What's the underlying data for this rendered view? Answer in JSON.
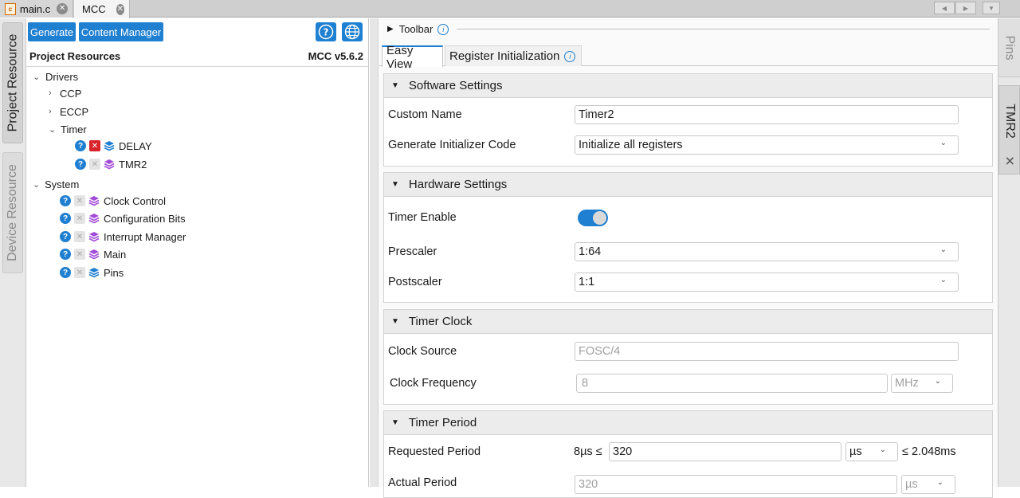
{
  "file_tabs": [
    {
      "label": "main.c",
      "icon": "c-file-icon"
    },
    {
      "label": "MCC",
      "icon": "mcc-icon"
    }
  ],
  "left_tabs": {
    "project_resource": "Project Resource",
    "device_resource": "Device Resource"
  },
  "right_tabs": {
    "pins": "Pins",
    "tmr2": "TMR2"
  },
  "toolbar_buttons": {
    "generate": "Generate",
    "content_manager": "Content Manager"
  },
  "resources": {
    "title": "Project Resources",
    "version": "MCC v5.6.2",
    "drivers_label": "Drivers",
    "ccp": "CCP",
    "eccp": "ECCP",
    "timer_label": "Timer",
    "delay": "DELAY",
    "tmr2": "TMR2",
    "system_label": "System",
    "clock_control": "Clock Control",
    "configuration_bits": "Configuration Bits",
    "interrupt_manager": "Interrupt Manager",
    "main": "Main",
    "pins": "Pins"
  },
  "editor": {
    "toolbar_label": "Toolbar",
    "tab_easy_view": "Easy View",
    "tab_register_init": "Register Initialization",
    "software_settings": {
      "title": "Software Settings",
      "custom_name_label": "Custom Name",
      "custom_name_value": "Timer2",
      "gen_init_label": "Generate Initializer Code",
      "gen_init_value": "Initialize all registers"
    },
    "hardware_settings": {
      "title": "Hardware Settings",
      "timer_enable_label": "Timer Enable",
      "timer_enable_on": true,
      "prescaler_label": "Prescaler",
      "prescaler_value": "1:64",
      "postscaler_label": "Postscaler",
      "postscaler_value": "1:1"
    },
    "timer_clock": {
      "title": "Timer Clock",
      "clock_source_label": "Clock Source",
      "clock_source_value": "FOSC/4",
      "clock_freq_label": "Clock Frequency",
      "clock_freq_value": "8",
      "clock_freq_unit": "MHz"
    },
    "timer_period": {
      "title": "Timer Period",
      "requested_label": "Requested Period",
      "requested_min": "8µs ≤",
      "requested_value": "320",
      "requested_unit": "µs",
      "requested_max": "≤ 2.048ms",
      "actual_label": "Actual Period",
      "actual_value": "320",
      "actual_unit": "µs"
    }
  },
  "colors": {
    "accent": "#1f7fd1",
    "error": "#d8232a",
    "layer_purple": "#a24bd8",
    "layer_blue": "#1f7fd1"
  }
}
